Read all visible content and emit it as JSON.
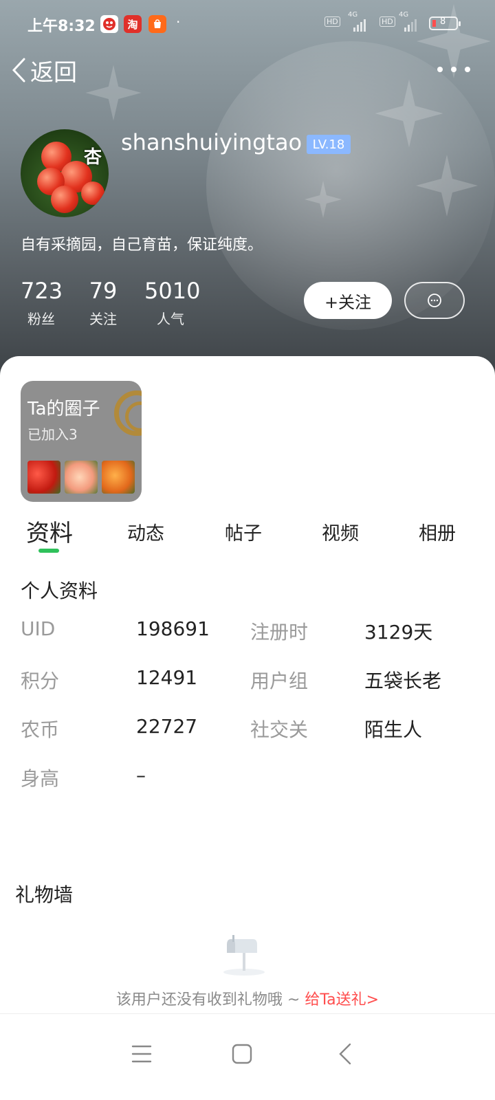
{
  "status_bar": {
    "time": "上午8:32",
    "battery": "8",
    "network_1": "4G",
    "network_2": "4G",
    "hd_1": "HD",
    "hd_2": "HD",
    "app_icon_2": "淘"
  },
  "nav": {
    "back_label": "返回"
  },
  "profile": {
    "username": "shanshuiyingtao",
    "level": "LV.18",
    "avatar_tag": "杏",
    "bio": "自有采摘园，自己育苗，保证纯度。",
    "stats": [
      {
        "value": "723",
        "label": "粉丝"
      },
      {
        "value": "79",
        "label": "关注"
      },
      {
        "value": "5010",
        "label": "人气"
      }
    ],
    "follow_label": "+关注"
  },
  "circle": {
    "title": "Ta的圈子",
    "joined": "已加入3"
  },
  "tabs": [
    "资料",
    "动态",
    "帖子",
    "视频",
    "相册"
  ],
  "active_tab_index": 0,
  "personal_info": {
    "title": "个人资料",
    "rows": [
      {
        "label_1": "UID",
        "value_1": "198691",
        "label_2": "注册时",
        "value_2": "3129天"
      },
      {
        "label_1": "积分",
        "value_1": "12491",
        "label_2": "用户组",
        "value_2": "五袋长老"
      },
      {
        "label_1": "农币",
        "value_1": "22727",
        "label_2": "社交关",
        "value_2": "陌生人"
      },
      {
        "label_1": "身高",
        "value_1": "–"
      }
    ]
  },
  "gift_wall": {
    "title": "礼物墙",
    "empty_text": "该用户还没有收到礼物哦 ~ ",
    "send_link": "给Ta送礼>"
  },
  "colors": {
    "accent_green": "#2fc15b",
    "link_red": "#ff4d4d",
    "level_badge_blue": "#8bb8ff"
  }
}
